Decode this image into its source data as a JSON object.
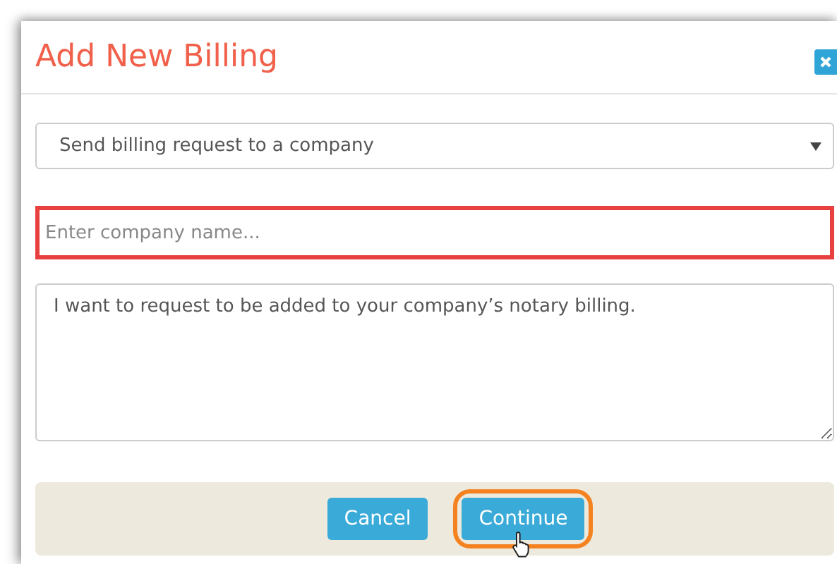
{
  "dialog": {
    "title": "Add New Billing"
  },
  "request_type": {
    "value": "Send billing request to a company"
  },
  "company_field": {
    "placeholder": "Enter company name...",
    "highlighted": true
  },
  "message": {
    "value": "I want to request to be added to your company’s notary billing."
  },
  "buttons": [
    {
      "label": "Cancel",
      "highlighted": false,
      "hovered": false
    },
    {
      "label": "Continue",
      "highlighted": true,
      "hovered": true
    }
  ]
}
